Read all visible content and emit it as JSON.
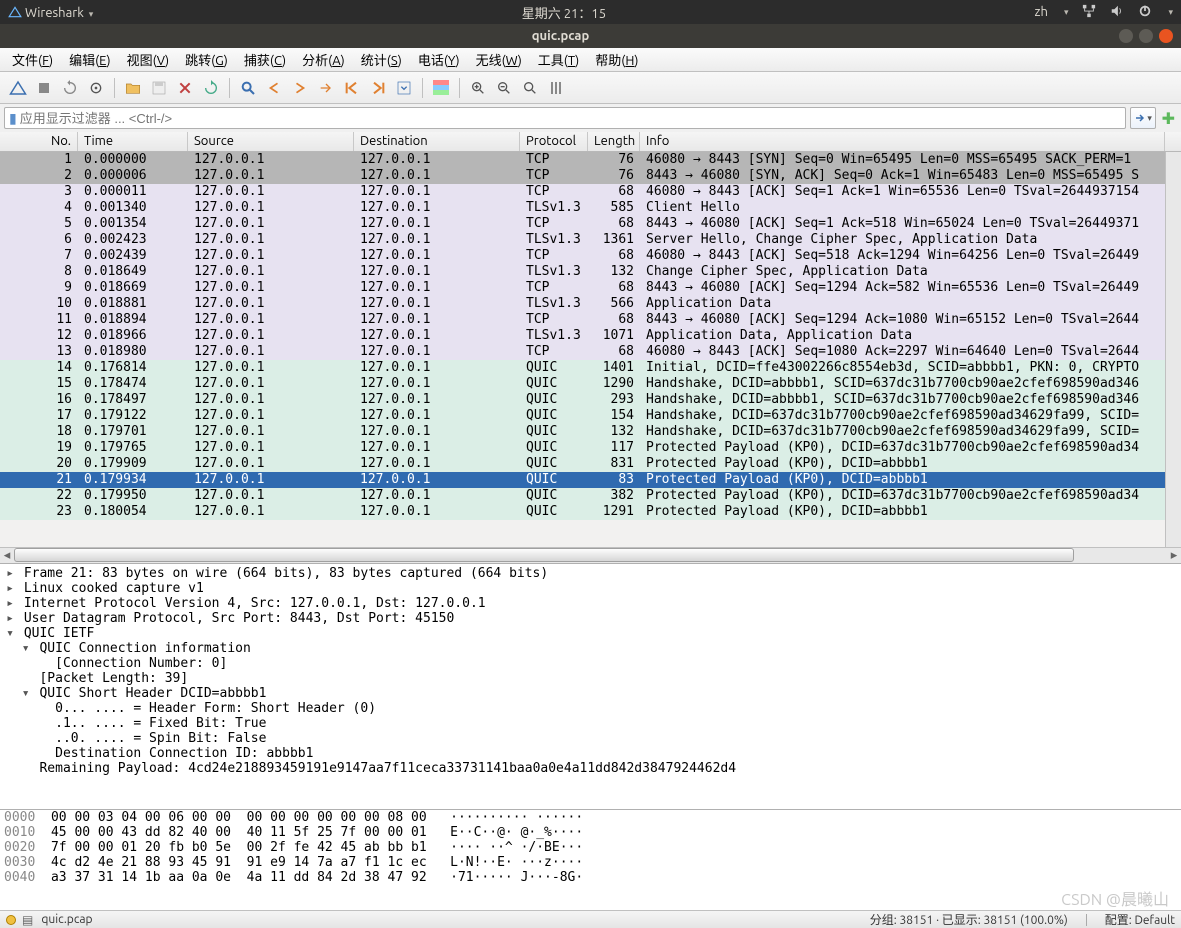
{
  "system": {
    "app_menu": "Wireshark",
    "clock": "星期六 21：15",
    "lang": "zh"
  },
  "window": {
    "title": "quic.pcap"
  },
  "menus": [
    {
      "label": "文件",
      "accel": "F"
    },
    {
      "label": "编辑",
      "accel": "E"
    },
    {
      "label": "视图",
      "accel": "V"
    },
    {
      "label": "跳转",
      "accel": "G"
    },
    {
      "label": "捕获",
      "accel": "C"
    },
    {
      "label": "分析",
      "accel": "A"
    },
    {
      "label": "统计",
      "accel": "S"
    },
    {
      "label": "电话",
      "accel": "Y"
    },
    {
      "label": "无线",
      "accel": "W"
    },
    {
      "label": "工具",
      "accel": "T"
    },
    {
      "label": "帮助",
      "accel": "H"
    }
  ],
  "filter": {
    "placeholder": "应用显示过滤器 ... <Ctrl-/>"
  },
  "columns": {
    "no": "No.",
    "time": "Time",
    "source": "Source",
    "destination": "Destination",
    "protocol": "Protocol",
    "length": "Length",
    "info": "Info"
  },
  "packets": [
    {
      "no": 1,
      "time": "0.000000",
      "src": "127.0.0.1",
      "dst": "127.0.0.1",
      "proto": "TCP",
      "len": 76,
      "info": "46080 → 8443 [SYN] Seq=0 Win=65495 Len=0 MSS=65495 SACK_PERM=1",
      "cls": "bg-gray"
    },
    {
      "no": 2,
      "time": "0.000006",
      "src": "127.0.0.1",
      "dst": "127.0.0.1",
      "proto": "TCP",
      "len": 76,
      "info": "8443 → 46080 [SYN, ACK] Seq=0 Ack=1 Win=65483 Len=0 MSS=65495 S",
      "cls": "bg-gray"
    },
    {
      "no": 3,
      "time": "0.000011",
      "src": "127.0.0.1",
      "dst": "127.0.0.1",
      "proto": "TCP",
      "len": 68,
      "info": "46080 → 8443 [ACK] Seq=1 Ack=1 Win=65536 Len=0 TSval=2644937154",
      "cls": "bg-purple"
    },
    {
      "no": 4,
      "time": "0.001340",
      "src": "127.0.0.1",
      "dst": "127.0.0.1",
      "proto": "TLSv1.3",
      "len": 585,
      "info": "Client Hello",
      "cls": "bg-purple"
    },
    {
      "no": 5,
      "time": "0.001354",
      "src": "127.0.0.1",
      "dst": "127.0.0.1",
      "proto": "TCP",
      "len": 68,
      "info": "8443 → 46080 [ACK] Seq=1 Ack=518 Win=65024 Len=0 TSval=26449371",
      "cls": "bg-purple"
    },
    {
      "no": 6,
      "time": "0.002423",
      "src": "127.0.0.1",
      "dst": "127.0.0.1",
      "proto": "TLSv1.3",
      "len": 1361,
      "info": "Server Hello, Change Cipher Spec, Application Data",
      "cls": "bg-purple"
    },
    {
      "no": 7,
      "time": "0.002439",
      "src": "127.0.0.1",
      "dst": "127.0.0.1",
      "proto": "TCP",
      "len": 68,
      "info": "46080 → 8443 [ACK] Seq=518 Ack=1294 Win=64256 Len=0 TSval=26449",
      "cls": "bg-purple"
    },
    {
      "no": 8,
      "time": "0.018649",
      "src": "127.0.0.1",
      "dst": "127.0.0.1",
      "proto": "TLSv1.3",
      "len": 132,
      "info": "Change Cipher Spec, Application Data",
      "cls": "bg-purple"
    },
    {
      "no": 9,
      "time": "0.018669",
      "src": "127.0.0.1",
      "dst": "127.0.0.1",
      "proto": "TCP",
      "len": 68,
      "info": "8443 → 46080 [ACK] Seq=1294 Ack=582 Win=65536 Len=0 TSval=26449",
      "cls": "bg-purple"
    },
    {
      "no": 10,
      "time": "0.018881",
      "src": "127.0.0.1",
      "dst": "127.0.0.1",
      "proto": "TLSv1.3",
      "len": 566,
      "info": "Application Data",
      "cls": "bg-purple"
    },
    {
      "no": 11,
      "time": "0.018894",
      "src": "127.0.0.1",
      "dst": "127.0.0.1",
      "proto": "TCP",
      "len": 68,
      "info": "8443 → 46080 [ACK] Seq=1294 Ack=1080 Win=65152 Len=0 TSval=2644",
      "cls": "bg-purple"
    },
    {
      "no": 12,
      "time": "0.018966",
      "src": "127.0.0.1",
      "dst": "127.0.0.1",
      "proto": "TLSv1.3",
      "len": 1071,
      "info": "Application Data, Application Data",
      "cls": "bg-purple"
    },
    {
      "no": 13,
      "time": "0.018980",
      "src": "127.0.0.1",
      "dst": "127.0.0.1",
      "proto": "TCP",
      "len": 68,
      "info": "46080 → 8443 [ACK] Seq=1080 Ack=2297 Win=64640 Len=0 TSval=2644",
      "cls": "bg-purple"
    },
    {
      "no": 14,
      "time": "0.176814",
      "src": "127.0.0.1",
      "dst": "127.0.0.1",
      "proto": "QUIC",
      "len": 1401,
      "info": "Initial, DCID=ffe43002266c8554eb3d, SCID=abbbb1, PKN: 0, CRYPTO",
      "cls": "bg-teal"
    },
    {
      "no": 15,
      "time": "0.178474",
      "src": "127.0.0.1",
      "dst": "127.0.0.1",
      "proto": "QUIC",
      "len": 1290,
      "info": "Handshake, DCID=abbbb1, SCID=637dc31b7700cb90ae2cfef698590ad346",
      "cls": "bg-teal"
    },
    {
      "no": 16,
      "time": "0.178497",
      "src": "127.0.0.1",
      "dst": "127.0.0.1",
      "proto": "QUIC",
      "len": 293,
      "info": "Handshake, DCID=abbbb1, SCID=637dc31b7700cb90ae2cfef698590ad346",
      "cls": "bg-teal"
    },
    {
      "no": 17,
      "time": "0.179122",
      "src": "127.0.0.1",
      "dst": "127.0.0.1",
      "proto": "QUIC",
      "len": 154,
      "info": "Handshake, DCID=637dc31b7700cb90ae2cfef698590ad34629fa99, SCID=",
      "cls": "bg-teal"
    },
    {
      "no": 18,
      "time": "0.179701",
      "src": "127.0.0.1",
      "dst": "127.0.0.1",
      "proto": "QUIC",
      "len": 132,
      "info": "Handshake, DCID=637dc31b7700cb90ae2cfef698590ad34629fa99, SCID=",
      "cls": "bg-teal"
    },
    {
      "no": 19,
      "time": "0.179765",
      "src": "127.0.0.1",
      "dst": "127.0.0.1",
      "proto": "QUIC",
      "len": 117,
      "info": "Protected Payload (KP0), DCID=637dc31b7700cb90ae2cfef698590ad34",
      "cls": "bg-teal"
    },
    {
      "no": 20,
      "time": "0.179909",
      "src": "127.0.0.1",
      "dst": "127.0.0.1",
      "proto": "QUIC",
      "len": 831,
      "info": "Protected Payload (KP0), DCID=abbbb1",
      "cls": "bg-teal"
    },
    {
      "no": 21,
      "time": "0.179934",
      "src": "127.0.0.1",
      "dst": "127.0.0.1",
      "proto": "QUIC",
      "len": 83,
      "info": "Protected Payload (KP0), DCID=abbbb1",
      "cls": "sel"
    },
    {
      "no": 22,
      "time": "0.179950",
      "src": "127.0.0.1",
      "dst": "127.0.0.1",
      "proto": "QUIC",
      "len": 382,
      "info": "Protected Payload (KP0), DCID=637dc31b7700cb90ae2cfef698590ad34",
      "cls": "bg-teal"
    },
    {
      "no": 23,
      "time": "0.180054",
      "src": "127.0.0.1",
      "dst": "127.0.0.1",
      "proto": "QUIC",
      "len": 1291,
      "info": "Protected Payload (KP0), DCID=abbbb1",
      "cls": "bg-teal"
    }
  ],
  "detail": [
    {
      "indent": 0,
      "exp": "▸",
      "text": "Frame 21: 83 bytes on wire (664 bits), 83 bytes captured (664 bits)"
    },
    {
      "indent": 0,
      "exp": "▸",
      "text": "Linux cooked capture v1"
    },
    {
      "indent": 0,
      "exp": "▸",
      "text": "Internet Protocol Version 4, Src: 127.0.0.1, Dst: 127.0.0.1"
    },
    {
      "indent": 0,
      "exp": "▸",
      "text": "User Datagram Protocol, Src Port: 8443, Dst Port: 45150"
    },
    {
      "indent": 0,
      "exp": "▾",
      "text": "QUIC IETF"
    },
    {
      "indent": 1,
      "exp": "▾",
      "text": "QUIC Connection information"
    },
    {
      "indent": 2,
      "exp": " ",
      "text": "[Connection Number: 0]"
    },
    {
      "indent": 1,
      "exp": " ",
      "text": "[Packet Length: 39]"
    },
    {
      "indent": 1,
      "exp": "▾",
      "text": "QUIC Short Header DCID=abbbb1"
    },
    {
      "indent": 2,
      "exp": " ",
      "text": "0... .... = Header Form: Short Header (0)"
    },
    {
      "indent": 2,
      "exp": " ",
      "text": ".1.. .... = Fixed Bit: True"
    },
    {
      "indent": 2,
      "exp": " ",
      "text": "..0. .... = Spin Bit: False"
    },
    {
      "indent": 2,
      "exp": " ",
      "text": "Destination Connection ID: abbbb1"
    },
    {
      "indent": 1,
      "exp": " ",
      "text": "Remaining Payload: 4cd24e218893459191e9147aa7f11ceca33731141baa0a0e4a11dd842d3847924462d4"
    }
  ],
  "hex": [
    {
      "off": "0000",
      "bytes": "00 00 03 04 00 06 00 00  00 00 00 00 00 00 08 00",
      "ascii": "·········· ······"
    },
    {
      "off": "0010",
      "bytes": "45 00 00 43 dd 82 40 00  40 11 5f 25 7f 00 00 01",
      "ascii": "E··C··@· @·_%····"
    },
    {
      "off": "0020",
      "bytes": "7f 00 00 01 20 fb b0 5e  00 2f fe 42 45 ab bb b1",
      "ascii": "···· ··^ ·/·BE···"
    },
    {
      "off": "0030",
      "bytes": "4c d2 4e 21 88 93 45 91  91 e9 14 7a a7 f1 1c ec",
      "ascii": "L·N!··E· ···z····"
    },
    {
      "off": "0040",
      "bytes": "a3 37 31 14 1b aa 0a 0e  4a 11 dd 84 2d 38 47 92",
      "ascii": "·71····· J···-8G·"
    }
  ],
  "status": {
    "file": "quic.pcap",
    "right": "分组: 38151 · 已显示: 38151 (100.0%)",
    "profile": "配置: Default"
  },
  "watermark": "CSDN @晨曦山"
}
